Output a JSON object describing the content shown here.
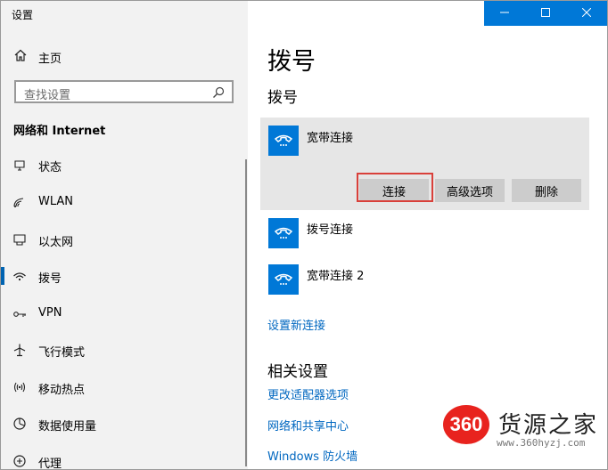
{
  "window": {
    "title": "设置"
  },
  "sidebar": {
    "home_label": "主页",
    "search_placeholder": "查找设置",
    "section_title": "网络和 Internet",
    "items": [
      {
        "label": "状态",
        "icon": "status-icon"
      },
      {
        "label": "WLAN",
        "icon": "wifi-icon"
      },
      {
        "label": "以太网",
        "icon": "ethernet-icon"
      },
      {
        "label": "拨号",
        "icon": "dialup-icon",
        "active": true
      },
      {
        "label": "VPN",
        "icon": "vpn-icon"
      },
      {
        "label": "飞行模式",
        "icon": "airplane-icon"
      },
      {
        "label": "移动热点",
        "icon": "hotspot-icon"
      },
      {
        "label": "数据使用量",
        "icon": "data-usage-icon"
      },
      {
        "label": "代理",
        "icon": "proxy-icon"
      }
    ]
  },
  "main": {
    "page_title": "拨号",
    "section_title": "拨号",
    "connections": [
      {
        "name": "宽带连接",
        "expanded": true
      },
      {
        "name": "拨号连接"
      },
      {
        "name": "宽带连接 2"
      }
    ],
    "buttons": {
      "connect": "连接",
      "advanced": "高级选项",
      "delete": "删除"
    },
    "new_connection_link": "设置新连接",
    "related_title": "相关设置",
    "related_links": [
      "更改适配器选项",
      "网络和共享中心",
      "Windows 防火墙"
    ]
  },
  "watermark": {
    "logo": "360",
    "brand": "货源之家",
    "url": "www.360hyzj.com"
  },
  "colors": {
    "accent": "#0078d7",
    "link": "#0067c0",
    "highlight": "#d9403a",
    "sidebar_bg": "#f2f2f2"
  }
}
